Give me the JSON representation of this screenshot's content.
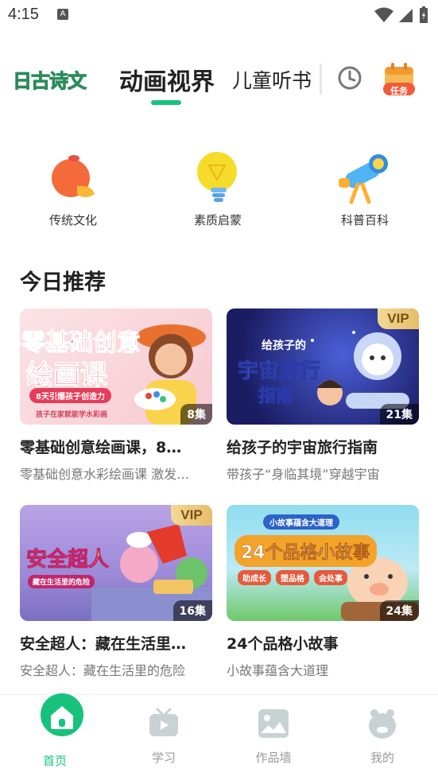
{
  "status_bar": {
    "time": "4:15",
    "notif_glyph": "A"
  },
  "top_tabs": {
    "logo_text": "古诗文",
    "logo_prefix": "日",
    "active_tab": "动画视界",
    "other_tab": "儿童听书",
    "task_badge": "任务"
  },
  "categories": [
    {
      "label": "传统文化",
      "icon": "orange-fruit-icon"
    },
    {
      "label": "素质启蒙",
      "icon": "lightbulb-icon"
    },
    {
      "label": "科普百科",
      "icon": "telescope-icon"
    }
  ],
  "section": {
    "title": "今日推荐"
  },
  "cards": [
    {
      "title": "零基础创意绘画课，8…",
      "subtitle": "零基础创意水彩绘画课 激发…",
      "episodes": "8集",
      "vip": "",
      "thumb_line1": "零基础创意",
      "thumb_line2": "绘画课",
      "thumb_ribbon": "8天引爆孩子创造力",
      "thumb_caption": "孩子在家就能学水彩画"
    },
    {
      "title": "给孩子的宇宙旅行指南",
      "subtitle": "带孩子“身临其境”穿越宇宙",
      "episodes": "21集",
      "vip": "VIP",
      "thumb_line1": "给孩子的",
      "thumb_line2": "宇宙旅行",
      "thumb_line3": "指南"
    },
    {
      "title": "安全超人：藏在生活里…",
      "subtitle": "安全超人：藏在生活里的危险",
      "episodes": "16集",
      "vip": "VIP",
      "thumb_line1": "安全超人",
      "thumb_ribbon": "藏在生活里的危险"
    },
    {
      "title": "24个品格小故事",
      "subtitle": "小故事蕴含大道理",
      "episodes": "24集",
      "vip": "",
      "thumb_top": "小故事蕴含大道理",
      "thumb_line1": "24个品格小故事",
      "tags": [
        "助成长",
        "塑品格",
        "会处事"
      ]
    }
  ],
  "bottom_nav": [
    {
      "label": "首页",
      "icon": "home-icon",
      "active": true
    },
    {
      "label": "学习",
      "icon": "tv-icon",
      "active": false
    },
    {
      "label": "作品墙",
      "icon": "picture-icon",
      "active": false
    },
    {
      "label": "我的",
      "icon": "piggy-face-icon",
      "active": false
    }
  ],
  "colors": {
    "accent": "#17c27d",
    "vip_gold": "#e6bd68",
    "text_primary": "#222222",
    "text_secondary": "#777777"
  }
}
